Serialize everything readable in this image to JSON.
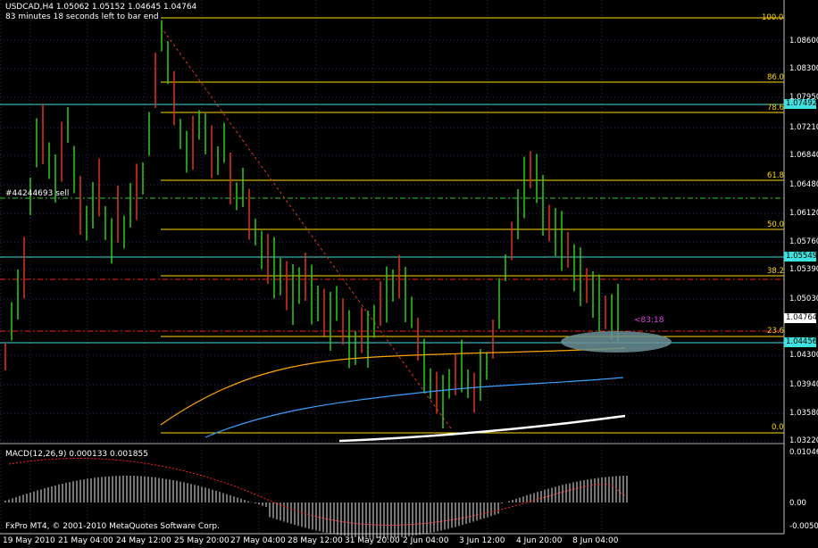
{
  "header": {
    "symbol_line": "USDCAD,H4  1.05062 1.05152 1.04645 1.04764",
    "timer_line": "83 minutes 18 seconds left to bar end"
  },
  "order_label": "#44244693 sell",
  "countdown_label": "<83:18",
  "copyright": "FxPro MT4, © 2001-2010 MetaQuotes Software Corp.",
  "macd_label": "MACD(12,26,9) 0.000133 0.001855",
  "y_axis_labels": [
    "1.08600",
    "1.08300",
    "1.07950",
    "1.07600",
    "1.07210",
    "1.06840",
    "1.06480",
    "1.06120",
    "1.05760",
    "1.05390",
    "1.05030",
    "1.04300",
    "1.03940",
    "1.03580",
    "1.03220"
  ],
  "macd_axis_labels": [
    "0.010468",
    "0.00",
    "-0.005083"
  ],
  "price_tags": {
    "current": "1.04764",
    "upper_line": "1.07492",
    "mid_line": "1.05549",
    "lower_line": "1.04456"
  },
  "fib_levels": [
    "100.0",
    "86.0",
    "78.6",
    "61.8",
    "50.0",
    "38.2",
    "23.6",
    "0.0"
  ],
  "x_axis_labels": [
    "19 May 2010",
    "21 May 04:00",
    "24 May 12:00",
    "25 May 20:00",
    "27 May 04:00",
    "28 May 12:00",
    "31 May 20:00",
    "2 Jun 04:00",
    "3 Jun 12:00",
    "4 Jun 20:00",
    "8 Jun 04:00"
  ],
  "colors": {
    "background": "#000000",
    "bull": "#2ecc1e",
    "bear": "#e0331e",
    "fib": "#ffd700",
    "cyan_line": "#40e0e0",
    "red_dash": "#ff2020",
    "green_dashdot": "#32cd32",
    "ma_orange": "#ffa500",
    "ma_blue": "#3aa0ff",
    "ma_white": "#ffffff",
    "grid": "#2a2a6a"
  }
}
